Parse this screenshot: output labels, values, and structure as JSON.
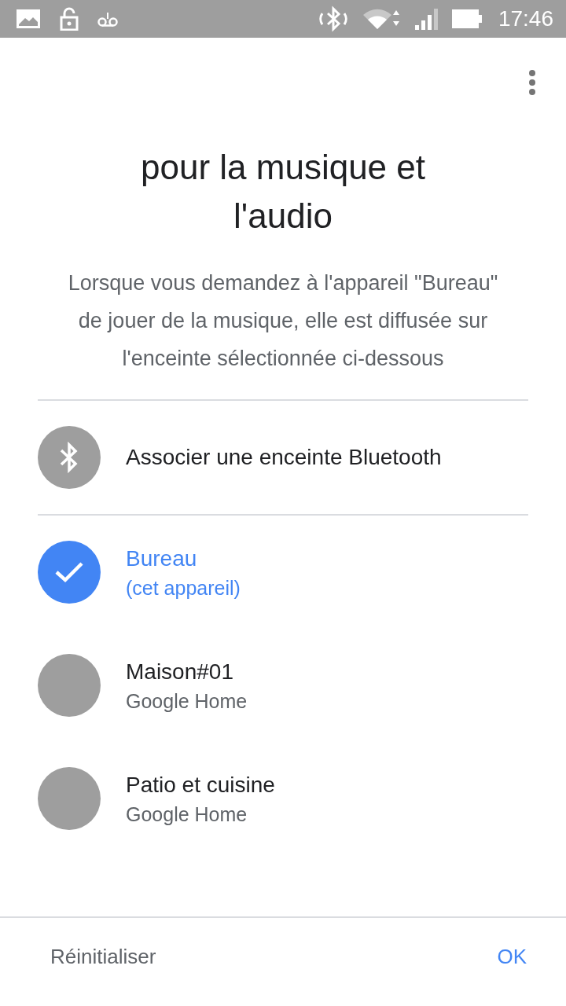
{
  "status_bar": {
    "time": "17:46"
  },
  "title": "pour la musique et l'audio",
  "description": "Lorsque vous demandez à l'appareil \"Bureau\" de jouer de la musique, elle est diffusée sur l'enceinte sélectionnée ci-dessous",
  "pair_action": {
    "label": "Associer une enceinte Bluetooth"
  },
  "devices": [
    {
      "name": "Bureau",
      "subtitle": "(cet appareil)",
      "selected": true
    },
    {
      "name": "Maison#01",
      "subtitle": "Google Home",
      "selected": false
    },
    {
      "name": "Patio et cuisine",
      "subtitle": "Google Home",
      "selected": false
    }
  ],
  "footer": {
    "reset": "Réinitialiser",
    "ok": "OK"
  }
}
